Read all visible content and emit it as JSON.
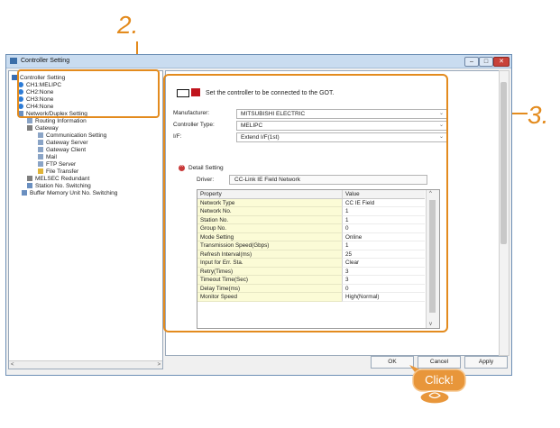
{
  "callouts": {
    "step2": "2.",
    "step3": "3."
  },
  "window": {
    "title": "Controller Setting",
    "controls": [
      "–",
      "□",
      "✕"
    ]
  },
  "tree": {
    "items": [
      {
        "label": "Controller Setting",
        "icon": "controller-setting-icon"
      },
      {
        "label": "CH1:MELIPC",
        "icon": "channel-icon"
      },
      {
        "label": "CH2:None",
        "icon": "channel-icon"
      },
      {
        "label": "CH3:None",
        "icon": "channel-icon"
      },
      {
        "label": "CH4:None",
        "icon": "channel-icon"
      },
      {
        "label": "Network/Duplex Setting",
        "icon": "network-icon"
      },
      {
        "label": "Routing Information",
        "icon": "routing-icon"
      },
      {
        "label": "Gateway",
        "icon": "gateway-icon"
      },
      {
        "label": "Communication Setting",
        "icon": "communication-icon"
      },
      {
        "label": "Gateway Server",
        "icon": "gateway-server-icon"
      },
      {
        "label": "Gateway Client",
        "icon": "gateway-client-icon"
      },
      {
        "label": "Mail",
        "icon": "mail-icon"
      },
      {
        "label": "FTP Server",
        "icon": "ftp-server-icon"
      },
      {
        "label": "File Transfer",
        "icon": "file-transfer-icon"
      },
      {
        "label": "MELSEC Redundant",
        "icon": "redundant-icon"
      },
      {
        "label": "Station No. Switching",
        "icon": "station-switch-icon"
      },
      {
        "label": "Buffer Memory Unit No. Switching",
        "icon": "buffer-memory-icon"
      }
    ]
  },
  "main": {
    "heading": "Set the controller to be connected to the GOT.",
    "fields": [
      {
        "label": "Manufacturer:",
        "value": "MITSUBISHI ELECTRIC"
      },
      {
        "label": "Controller Type:",
        "value": "MELIPC"
      },
      {
        "label": "I/F:",
        "value": "Extend I/F(1st)"
      }
    ],
    "detail_title": "Detail Setting",
    "driver_label": "Driver:",
    "driver_value": "CC-Link IE Field Network",
    "grid": {
      "headers": [
        "Property",
        "Value"
      ],
      "rows": [
        [
          "Network Type",
          "CC IE Field"
        ],
        [
          "Network No.",
          "1"
        ],
        [
          "Station No.",
          "1"
        ],
        [
          "Group No.",
          "0"
        ],
        [
          "Mode Setting",
          "Online"
        ],
        [
          "Transmission Speed(Gbps)",
          "1"
        ],
        [
          "Refresh Interval(ms)",
          "25"
        ],
        [
          "Input for Err. Sta.",
          "Clear"
        ],
        [
          "Retry(Times)",
          "3"
        ],
        [
          "Timeout Time(Sec)",
          "3"
        ],
        [
          "Delay Time(ms)",
          "0"
        ],
        [
          "Monitor Speed",
          "High(Normal)"
        ]
      ]
    }
  },
  "buttons": {
    "ok": "OK",
    "cancel": "Cancel",
    "apply": "Apply"
  },
  "click_label": "Click!",
  "colors": {
    "accent": "#e38b1e",
    "titlebar": "#c9dcf0",
    "property_cell": "#fbfbd6",
    "close": "#c8423a"
  }
}
